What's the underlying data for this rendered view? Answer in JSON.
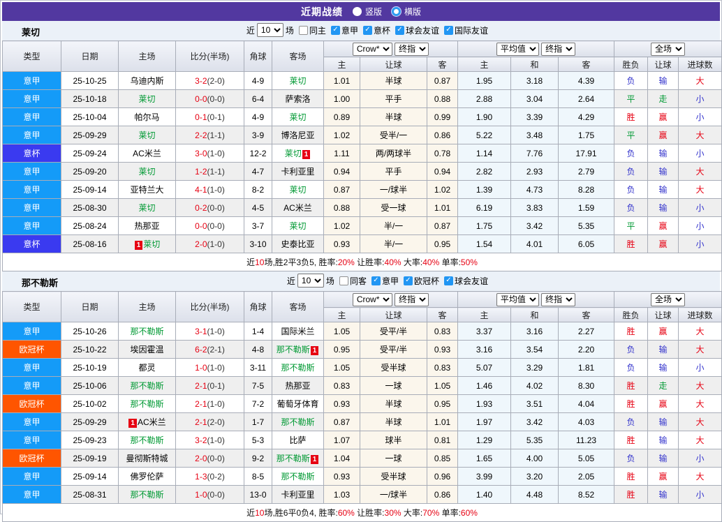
{
  "title_bar": {
    "title": "近期战绩",
    "radio_options": [
      {
        "label": "竖版",
        "selected": true
      },
      {
        "label": "横版",
        "selected": false
      }
    ]
  },
  "colors": {
    "competition": {
      "意甲": "#149BF8",
      "意杯": "#3A3AF0",
      "欧冠杯": "#FF5500"
    },
    "result": {
      "red": "#E60012",
      "green": "#009933",
      "blue": "#3333CC"
    },
    "team_highlight": "#009933",
    "title_bar_bg": "#5238A0"
  },
  "columns": {
    "type": "类型",
    "date": "日期",
    "home": "主场",
    "score": "比分(半场)",
    "corner": "角球",
    "away": "客场",
    "odds_home": "主",
    "odds_handicap": "让球",
    "odds_away": "客",
    "avg_home": "主",
    "avg_draw": "和",
    "avg_away": "客",
    "result_wdl": "胜负",
    "result_handicap": "让球",
    "result_goals": "进球数"
  },
  "header_dropdowns": {
    "odds_source": "Crow*",
    "odds_time": "终指",
    "avg_source": "平均值",
    "avg_time": "终指",
    "scope": "全场"
  },
  "sections": [
    {
      "team": "莱切",
      "filter": {
        "prefix": "近",
        "matches_value": "10",
        "suffix": "场",
        "same_venue_label": "同主",
        "same_venue_checked": false,
        "competitions": [
          {
            "label": "意甲",
            "checked": true
          },
          {
            "label": "意杯",
            "checked": true
          },
          {
            "label": "球会友谊",
            "checked": true
          },
          {
            "label": "国际友谊",
            "checked": true
          }
        ]
      },
      "rows": [
        {
          "type": "意甲",
          "date": "25-10-25",
          "home": {
            "name": "乌迪内斯",
            "hl": false,
            "rc": ""
          },
          "score": "3-2",
          "half": "(2-0)",
          "corner": "4-9",
          "away": {
            "name": "莱切",
            "hl": true,
            "rc": ""
          },
          "odds": [
            "1.01",
            "半球",
            "0.87"
          ],
          "avg": [
            "1.95",
            "3.18",
            "4.39"
          ],
          "results": [
            [
              "负",
              "blue"
            ],
            [
              "输",
              "blue"
            ],
            [
              "大",
              "red"
            ]
          ]
        },
        {
          "type": "意甲",
          "date": "25-10-18",
          "home": {
            "name": "莱切",
            "hl": true,
            "rc": ""
          },
          "score": "0-0",
          "half": "(0-0)",
          "corner": "6-4",
          "away": {
            "name": "萨索洛",
            "hl": false,
            "rc": ""
          },
          "odds": [
            "1.00",
            "平手",
            "0.88"
          ],
          "avg": [
            "2.88",
            "3.04",
            "2.64"
          ],
          "results": [
            [
              "平",
              "green"
            ],
            [
              "走",
              "green"
            ],
            [
              "小",
              "blue"
            ]
          ]
        },
        {
          "type": "意甲",
          "date": "25-10-04",
          "home": {
            "name": "帕尔马",
            "hl": false,
            "rc": ""
          },
          "score": "0-1",
          "half": "(0-1)",
          "corner": "4-9",
          "away": {
            "name": "莱切",
            "hl": true,
            "rc": ""
          },
          "odds": [
            "0.89",
            "半球",
            "0.99"
          ],
          "avg": [
            "1.90",
            "3.39",
            "4.29"
          ],
          "results": [
            [
              "胜",
              "red"
            ],
            [
              "赢",
              "red"
            ],
            [
              "小",
              "blue"
            ]
          ]
        },
        {
          "type": "意甲",
          "date": "25-09-29",
          "home": {
            "name": "莱切",
            "hl": true,
            "rc": ""
          },
          "score": "2-2",
          "half": "(1-1)",
          "corner": "3-9",
          "away": {
            "name": "博洛尼亚",
            "hl": false,
            "rc": ""
          },
          "odds": [
            "1.02",
            "受半/一",
            "0.86"
          ],
          "avg": [
            "5.22",
            "3.48",
            "1.75"
          ],
          "results": [
            [
              "平",
              "green"
            ],
            [
              "赢",
              "red"
            ],
            [
              "大",
              "red"
            ]
          ]
        },
        {
          "type": "意杯",
          "date": "25-09-24",
          "home": {
            "name": "AC米兰",
            "hl": false,
            "rc": ""
          },
          "score": "3-0",
          "half": "(1-0)",
          "corner": "12-2",
          "away": {
            "name": "莱切",
            "hl": true,
            "rc": "1"
          },
          "odds": [
            "1.11",
            "两/两球半",
            "0.78"
          ],
          "avg": [
            "1.14",
            "7.76",
            "17.91"
          ],
          "results": [
            [
              "负",
              "blue"
            ],
            [
              "输",
              "blue"
            ],
            [
              "小",
              "blue"
            ]
          ]
        },
        {
          "type": "意甲",
          "date": "25-09-20",
          "home": {
            "name": "莱切",
            "hl": true,
            "rc": ""
          },
          "score": "1-2",
          "half": "(1-1)",
          "corner": "4-7",
          "away": {
            "name": "卡利亚里",
            "hl": false,
            "rc": ""
          },
          "odds": [
            "0.94",
            "平手",
            "0.94"
          ],
          "avg": [
            "2.82",
            "2.93",
            "2.79"
          ],
          "results": [
            [
              "负",
              "blue"
            ],
            [
              "输",
              "blue"
            ],
            [
              "大",
              "red"
            ]
          ]
        },
        {
          "type": "意甲",
          "date": "25-09-14",
          "home": {
            "name": "亚特兰大",
            "hl": false,
            "rc": ""
          },
          "score": "4-1",
          "half": "(1-0)",
          "corner": "8-2",
          "away": {
            "name": "莱切",
            "hl": true,
            "rc": ""
          },
          "odds": [
            "0.87",
            "一/球半",
            "1.02"
          ],
          "avg": [
            "1.39",
            "4.73",
            "8.28"
          ],
          "results": [
            [
              "负",
              "blue"
            ],
            [
              "输",
              "blue"
            ],
            [
              "大",
              "red"
            ]
          ]
        },
        {
          "type": "意甲",
          "date": "25-08-30",
          "home": {
            "name": "莱切",
            "hl": true,
            "rc": ""
          },
          "score": "0-2",
          "half": "(0-0)",
          "corner": "4-5",
          "away": {
            "name": "AC米兰",
            "hl": false,
            "rc": ""
          },
          "odds": [
            "0.88",
            "受一球",
            "1.01"
          ],
          "avg": [
            "6.19",
            "3.83",
            "1.59"
          ],
          "results": [
            [
              "负",
              "blue"
            ],
            [
              "输",
              "blue"
            ],
            [
              "小",
              "blue"
            ]
          ]
        },
        {
          "type": "意甲",
          "date": "25-08-24",
          "home": {
            "name": "热那亚",
            "hl": false,
            "rc": ""
          },
          "score": "0-0",
          "half": "(0-0)",
          "corner": "3-7",
          "away": {
            "name": "莱切",
            "hl": true,
            "rc": ""
          },
          "odds": [
            "1.02",
            "半/一",
            "0.87"
          ],
          "avg": [
            "1.75",
            "3.42",
            "5.35"
          ],
          "results": [
            [
              "平",
              "green"
            ],
            [
              "赢",
              "red"
            ],
            [
              "小",
              "blue"
            ]
          ]
        },
        {
          "type": "意杯",
          "date": "25-08-16",
          "home": {
            "name": "莱切",
            "hl": true,
            "rc": "1"
          },
          "score": "2-0",
          "half": "(1-0)",
          "corner": "3-10",
          "away": {
            "name": "史泰比亚",
            "hl": false,
            "rc": ""
          },
          "odds": [
            "0.93",
            "半/一",
            "0.95"
          ],
          "avg": [
            "1.54",
            "4.01",
            "6.05"
          ],
          "results": [
            [
              "胜",
              "red"
            ],
            [
              "赢",
              "red"
            ],
            [
              "小",
              "blue"
            ]
          ]
        }
      ],
      "summary": [
        {
          "t": "近",
          "red": false
        },
        {
          "t": "10",
          "red": true
        },
        {
          "t": "场,胜2平3负5, 胜率:",
          "red": false
        },
        {
          "t": "20%",
          "red": true
        },
        {
          "t": " 让胜率:",
          "red": false
        },
        {
          "t": "40%",
          "red": true
        },
        {
          "t": " 大率:",
          "red": false
        },
        {
          "t": "40%",
          "red": true
        },
        {
          "t": " 单率:",
          "red": false
        },
        {
          "t": "50%",
          "red": true
        }
      ]
    },
    {
      "team": "那不勒斯",
      "filter": {
        "prefix": "近",
        "matches_value": "10",
        "suffix": "场",
        "same_venue_label": "同客",
        "same_venue_checked": false,
        "competitions": [
          {
            "label": "意甲",
            "checked": true
          },
          {
            "label": "欧冠杯",
            "checked": true
          },
          {
            "label": "球会友谊",
            "checked": true
          }
        ]
      },
      "rows": [
        {
          "type": "意甲",
          "date": "25-10-26",
          "home": {
            "name": "那不勒斯",
            "hl": true,
            "rc": ""
          },
          "score": "3-1",
          "half": "(1-0)",
          "corner": "1-4",
          "away": {
            "name": "国际米兰",
            "hl": false,
            "rc": ""
          },
          "odds": [
            "1.05",
            "受平/半",
            "0.83"
          ],
          "avg": [
            "3.37",
            "3.16",
            "2.27"
          ],
          "results": [
            [
              "胜",
              "red"
            ],
            [
              "赢",
              "red"
            ],
            [
              "大",
              "red"
            ]
          ]
        },
        {
          "type": "欧冠杯",
          "date": "25-10-22",
          "home": {
            "name": "埃因霍温",
            "hl": false,
            "rc": ""
          },
          "score": "6-2",
          "half": "(2-1)",
          "corner": "4-8",
          "away": {
            "name": "那不勒斯",
            "hl": true,
            "rc": "1"
          },
          "odds": [
            "0.95",
            "受平/半",
            "0.93"
          ],
          "avg": [
            "3.16",
            "3.54",
            "2.20"
          ],
          "results": [
            [
              "负",
              "blue"
            ],
            [
              "输",
              "blue"
            ],
            [
              "大",
              "red"
            ]
          ]
        },
        {
          "type": "意甲",
          "date": "25-10-19",
          "home": {
            "name": "都灵",
            "hl": false,
            "rc": ""
          },
          "score": "1-0",
          "half": "(1-0)",
          "corner": "3-11",
          "away": {
            "name": "那不勒斯",
            "hl": true,
            "rc": ""
          },
          "odds": [
            "1.05",
            "受半球",
            "0.83"
          ],
          "avg": [
            "5.07",
            "3.29",
            "1.81"
          ],
          "results": [
            [
              "负",
              "blue"
            ],
            [
              "输",
              "blue"
            ],
            [
              "小",
              "blue"
            ]
          ]
        },
        {
          "type": "意甲",
          "date": "25-10-06",
          "home": {
            "name": "那不勒斯",
            "hl": true,
            "rc": ""
          },
          "score": "2-1",
          "half": "(0-1)",
          "corner": "7-5",
          "away": {
            "name": "热那亚",
            "hl": false,
            "rc": ""
          },
          "odds": [
            "0.83",
            "一球",
            "1.05"
          ],
          "avg": [
            "1.46",
            "4.02",
            "8.30"
          ],
          "results": [
            [
              "胜",
              "red"
            ],
            [
              "走",
              "green"
            ],
            [
              "大",
              "red"
            ]
          ]
        },
        {
          "type": "欧冠杯",
          "date": "25-10-02",
          "home": {
            "name": "那不勒斯",
            "hl": true,
            "rc": ""
          },
          "score": "2-1",
          "half": "(1-0)",
          "corner": "7-2",
          "away": {
            "name": "葡萄牙体育",
            "hl": false,
            "rc": ""
          },
          "odds": [
            "0.93",
            "半球",
            "0.95"
          ],
          "avg": [
            "1.93",
            "3.51",
            "4.04"
          ],
          "results": [
            [
              "胜",
              "red"
            ],
            [
              "赢",
              "red"
            ],
            [
              "大",
              "red"
            ]
          ]
        },
        {
          "type": "意甲",
          "date": "25-09-29",
          "home": {
            "name": "AC米兰",
            "hl": false,
            "rc": "1"
          },
          "score": "2-1",
          "half": "(2-0)",
          "corner": "1-7",
          "away": {
            "name": "那不勒斯",
            "hl": true,
            "rc": ""
          },
          "odds": [
            "0.87",
            "半球",
            "1.01"
          ],
          "avg": [
            "1.97",
            "3.42",
            "4.03"
          ],
          "results": [
            [
              "负",
              "blue"
            ],
            [
              "输",
              "blue"
            ],
            [
              "大",
              "red"
            ]
          ]
        },
        {
          "type": "意甲",
          "date": "25-09-23",
          "home": {
            "name": "那不勒斯",
            "hl": true,
            "rc": ""
          },
          "score": "3-2",
          "half": "(1-0)",
          "corner": "5-3",
          "away": {
            "name": "比萨",
            "hl": false,
            "rc": ""
          },
          "odds": [
            "1.07",
            "球半",
            "0.81"
          ],
          "avg": [
            "1.29",
            "5.35",
            "11.23"
          ],
          "results": [
            [
              "胜",
              "red"
            ],
            [
              "输",
              "blue"
            ],
            [
              "大",
              "red"
            ]
          ]
        },
        {
          "type": "欧冠杯",
          "date": "25-09-19",
          "home": {
            "name": "曼彻斯特城",
            "hl": false,
            "rc": ""
          },
          "score": "2-0",
          "half": "(0-0)",
          "corner": "9-2",
          "away": {
            "name": "那不勒斯",
            "hl": true,
            "rc": "1"
          },
          "odds": [
            "1.04",
            "一球",
            "0.85"
          ],
          "avg": [
            "1.65",
            "4.00",
            "5.05"
          ],
          "results": [
            [
              "负",
              "blue"
            ],
            [
              "输",
              "blue"
            ],
            [
              "小",
              "blue"
            ]
          ]
        },
        {
          "type": "意甲",
          "date": "25-09-14",
          "home": {
            "name": "佛罗伦萨",
            "hl": false,
            "rc": ""
          },
          "score": "1-3",
          "half": "(0-2)",
          "corner": "8-5",
          "away": {
            "name": "那不勒斯",
            "hl": true,
            "rc": ""
          },
          "odds": [
            "0.93",
            "受半球",
            "0.96"
          ],
          "avg": [
            "3.99",
            "3.20",
            "2.05"
          ],
          "results": [
            [
              "胜",
              "red"
            ],
            [
              "赢",
              "red"
            ],
            [
              "大",
              "red"
            ]
          ]
        },
        {
          "type": "意甲",
          "date": "25-08-31",
          "home": {
            "name": "那不勒斯",
            "hl": true,
            "rc": ""
          },
          "score": "1-0",
          "half": "(0-0)",
          "corner": "13-0",
          "away": {
            "name": "卡利亚里",
            "hl": false,
            "rc": ""
          },
          "odds": [
            "1.03",
            "一/球半",
            "0.86"
          ],
          "avg": [
            "1.40",
            "4.48",
            "8.52"
          ],
          "results": [
            [
              "胜",
              "red"
            ],
            [
              "输",
              "blue"
            ],
            [
              "小",
              "blue"
            ]
          ]
        }
      ],
      "summary": [
        {
          "t": "近",
          "red": false
        },
        {
          "t": "10",
          "red": true
        },
        {
          "t": "场,胜6平0负4, 胜率:",
          "red": false
        },
        {
          "t": "60%",
          "red": true
        },
        {
          "t": " 让胜率:",
          "red": false
        },
        {
          "t": "30%",
          "red": true
        },
        {
          "t": " 大率:",
          "red": false
        },
        {
          "t": "70%",
          "red": true
        },
        {
          "t": " 单率:",
          "red": false
        },
        {
          "t": "60%",
          "red": true
        }
      ]
    }
  ]
}
